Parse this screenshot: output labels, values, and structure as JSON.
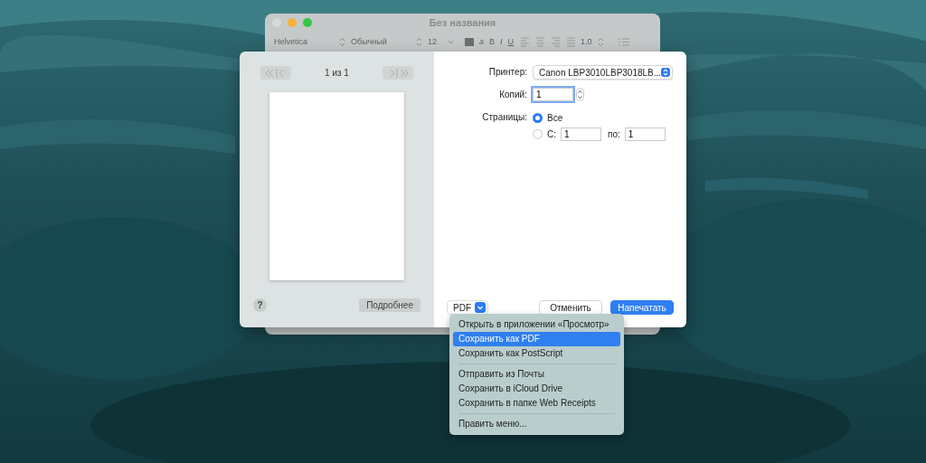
{
  "document_window": {
    "title": "Без названия",
    "toolbar": {
      "font": "Helvetica",
      "style": "Обычный",
      "size": "12",
      "italic_letter": "a",
      "bold": "B",
      "italic": "I",
      "underline": "U",
      "spacing": "1,0"
    }
  },
  "print_dialog": {
    "preview": {
      "page_counter": "1 из 1",
      "help": "?",
      "details_button": "Подробнее"
    },
    "printer": {
      "label": "Принтер:",
      "value": "Canon LBP3010LBP3018LB..."
    },
    "copies": {
      "label": "Копий:",
      "value": "1",
      "focused": true
    },
    "pages": {
      "label": "Страницы:",
      "options": [
        {
          "kind": "all",
          "label": "Все",
          "selected": true
        },
        {
          "kind": "range",
          "label": "С:",
          "from": "1",
          "to_label": "по:",
          "to": "1",
          "selected": false
        }
      ]
    },
    "pdf_button": "PDF",
    "buttons": [
      {
        "label": "Отменить",
        "default": false
      },
      {
        "label": "Напечатать",
        "default": true
      }
    ]
  },
  "pdf_menu": {
    "items": [
      {
        "kind": "item",
        "label": "Открыть в приложении «Просмотр»",
        "selected": false
      },
      {
        "kind": "item",
        "label": "Сохранить как PDF",
        "selected": true
      },
      {
        "kind": "item",
        "label": "Сохранить как PostScript",
        "selected": false
      },
      {
        "kind": "separator"
      },
      {
        "kind": "item",
        "label": "Отправить из Почты",
        "selected": false
      },
      {
        "kind": "item",
        "label": "Сохранить в iCloud Drive",
        "selected": false
      },
      {
        "kind": "item",
        "label": "Сохранить в папке Web Receipts",
        "selected": false
      },
      {
        "kind": "separator"
      },
      {
        "kind": "item",
        "label": "Править меню...",
        "selected": false
      }
    ]
  }
}
